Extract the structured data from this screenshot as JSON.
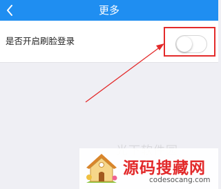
{
  "header": {
    "title": "更多",
    "back_icon": "chevron-left-icon",
    "background": "#1f8ef1"
  },
  "settings": {
    "face_login_label": "是否开启刷脸登录",
    "face_login_enabled": false
  },
  "annotation": {
    "color": "#e32a2a"
  },
  "watermark": {
    "faint_text": "光下软件园",
    "name": "源码搜藏网",
    "url": "codesocang.com"
  }
}
